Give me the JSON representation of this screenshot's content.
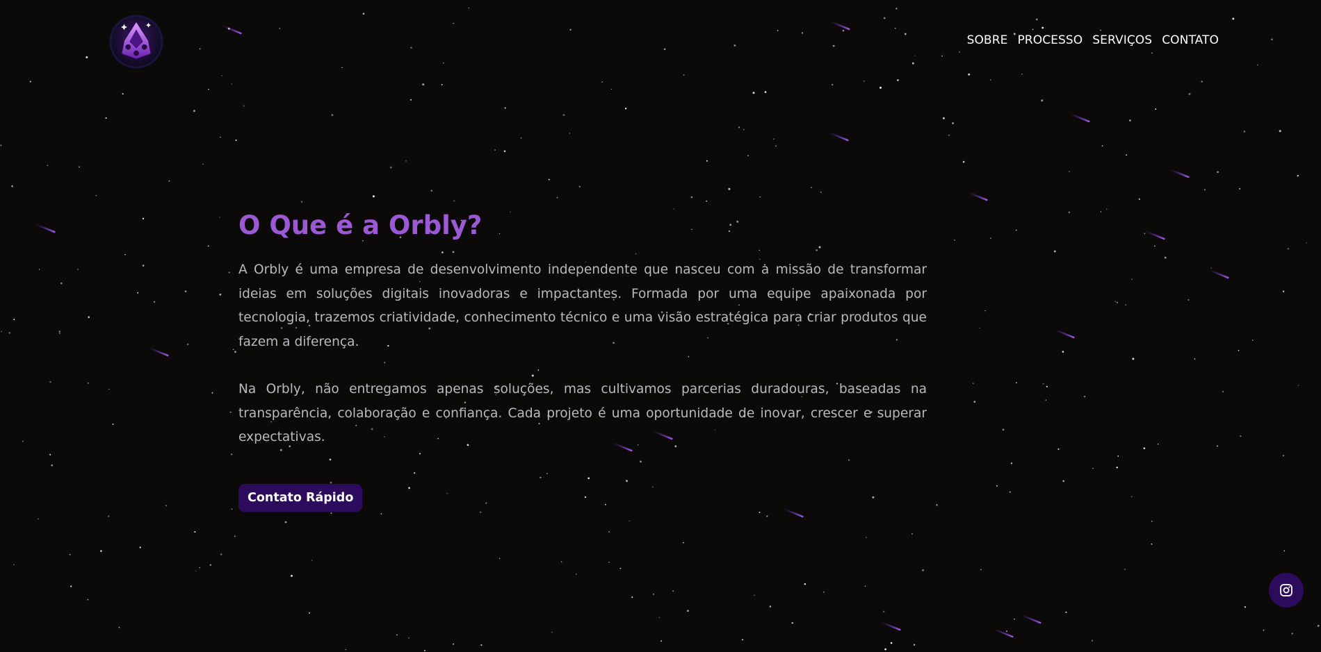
{
  "header": {
    "logo_icon": "orbly-crown-logo",
    "nav": [
      {
        "label": "SOBRE"
      },
      {
        "label": "PROCESSO"
      },
      {
        "label": "SERVIÇOS"
      },
      {
        "label": "CONTATO"
      }
    ]
  },
  "about": {
    "title": "O Que é a Orbly?",
    "paragraphs": [
      "A Orbly é uma empresa de desenvolvimento independente que nasceu com a missão de transformar ideias em soluções digitais inovadoras e impactantes. Formada por uma equipe apaixonada por tecnologia, trazemos criatividade, conhecimento técnico e uma visão estratégica para criar produtos que fazem a diferença.",
      "Na Orbly, não entregamos apenas soluções, mas cultivamos parcerias duradouras, baseadas na transparência, colaboração e confiança. Cada projeto é uma oportunidade de inovar, crescer e superar expectativas."
    ],
    "cta_label": "Contato Rápido"
  },
  "social": {
    "icon": "instagram-icon"
  },
  "colors": {
    "background": "#0b0a09",
    "accent": "#9b59d6",
    "button": "#2c0a5c",
    "text": "#bcb8c0"
  }
}
